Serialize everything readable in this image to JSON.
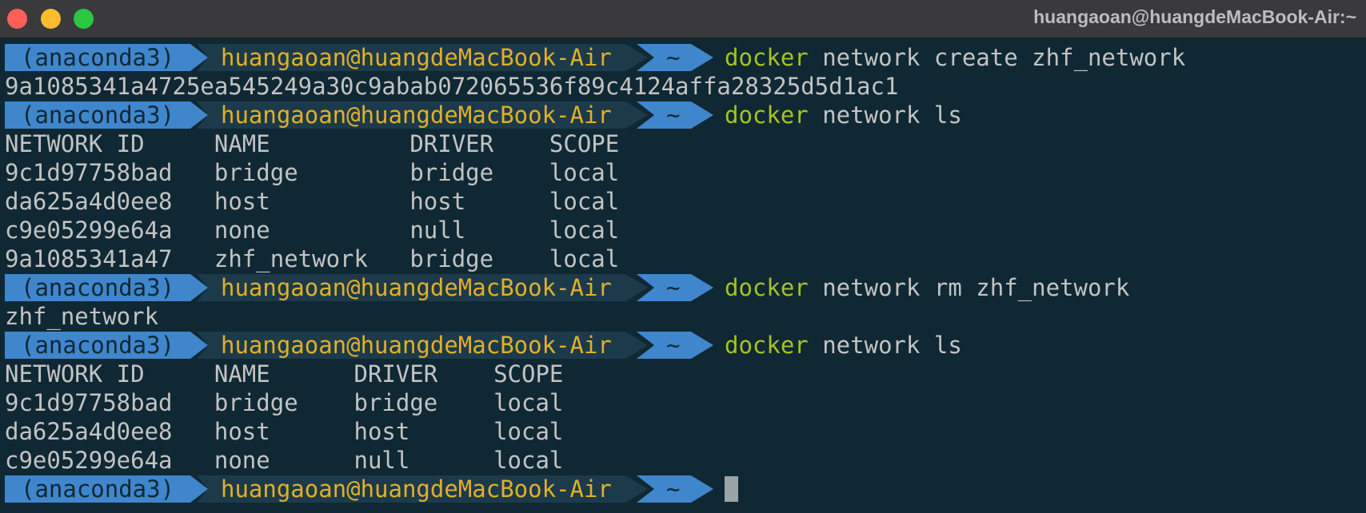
{
  "window": {
    "title": "huangaoan@huangdeMacBook-Air:~",
    "traffic_lights": [
      "close",
      "minimize",
      "zoom"
    ],
    "colors": {
      "background": "#0f2834",
      "prompt_segment_blue": "#3f86cc",
      "prompt_user": "#e0b029",
      "command_word": "#a8c221",
      "text": "#c3c3c3"
    }
  },
  "prompt": {
    "env": "(anaconda3)",
    "user": "huangaoan@huangdeMacBook-Air",
    "dir": "~"
  },
  "lines": [
    {
      "kind": "prompt",
      "cmd": "docker",
      "args": " network create zhf_network"
    },
    {
      "kind": "output",
      "text": "9a1085341a4725ea545249a30c9abab072065536f89c4124affa28325d5d1ac1"
    },
    {
      "kind": "prompt",
      "cmd": "docker",
      "args": " network ls"
    },
    {
      "kind": "output",
      "text": "NETWORK ID     NAME          DRIVER    SCOPE"
    },
    {
      "kind": "output",
      "text": "9c1d97758bad   bridge        bridge    local"
    },
    {
      "kind": "output",
      "text": "da625a4d0ee8   host          host      local"
    },
    {
      "kind": "output",
      "text": "c9e05299e64a   none          null      local"
    },
    {
      "kind": "output",
      "text": "9a1085341a47   zhf_network   bridge    local"
    },
    {
      "kind": "prompt",
      "cmd": "docker",
      "args": " network rm zhf_network"
    },
    {
      "kind": "output",
      "text": "zhf_network"
    },
    {
      "kind": "prompt",
      "cmd": "docker",
      "args": " network ls"
    },
    {
      "kind": "output",
      "text": "NETWORK ID     NAME      DRIVER    SCOPE"
    },
    {
      "kind": "output",
      "text": "9c1d97758bad   bridge    bridge    local"
    },
    {
      "kind": "output",
      "text": "da625a4d0ee8   host      host      local"
    },
    {
      "kind": "output",
      "text": "c9e05299e64a   none      null      local"
    },
    {
      "kind": "prompt",
      "cmd": "",
      "args": "",
      "cursor": true
    }
  ]
}
